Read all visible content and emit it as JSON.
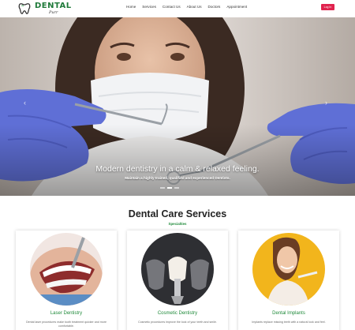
{
  "brand": {
    "name": "DENTAL",
    "tagline": "Purr"
  },
  "nav": {
    "links": [
      "Home",
      "Services",
      "Contact Us",
      "About Us",
      "Doctors",
      "Appointment"
    ],
    "cta_label": "Log In"
  },
  "hero": {
    "title": "Modern dentistry in a calm & relaxed feeling.",
    "subtitle": "Maintain a highly trained, qualified and experienced Dentists.",
    "prev_arrow": "‹",
    "next_arrow": "›",
    "slide_count": 3,
    "active_slide": 1
  },
  "services": {
    "title": "Dental Care Services",
    "subtitle": "Specialties",
    "cards": [
      {
        "title": "Laser Dentistry",
        "description": "Dental laser procedures make tooth treatment quicker and more comfortable."
      },
      {
        "title": "Cosmetic Dentistry",
        "description": "Cosmetic procedures improve the look of your teeth and smile."
      },
      {
        "title": "Dental Implants",
        "description": "Implants replace missing teeth with a natural look and feel."
      }
    ]
  },
  "colors": {
    "brand_green": "#1f7a3a",
    "cta_red": "#e0234e",
    "card_title_green": "#1f8a3a"
  }
}
